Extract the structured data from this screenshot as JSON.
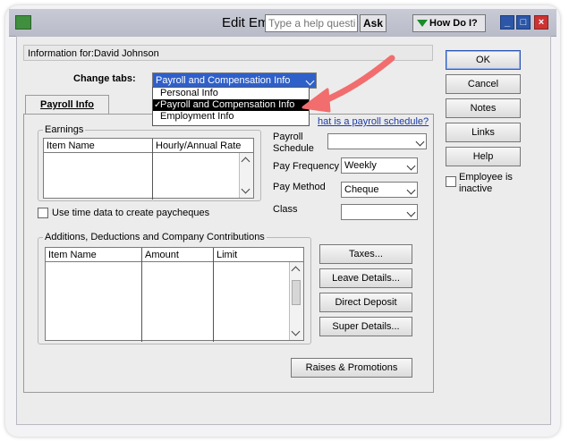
{
  "window": {
    "title": "Edit Em",
    "help_placeholder": "Type a help question",
    "ask_label": "Ask",
    "howdoi_label": "How Do I?"
  },
  "dialog": {
    "info_label": "Information for:",
    "employee_name": "David Johnson",
    "change_tabs_label": "Change tabs:",
    "change_tabs_value": "Payroll and Compensation Info",
    "dropdown_options": [
      {
        "label": "Personal Info",
        "selected": false
      },
      {
        "label": "Payroll and Compensation Info",
        "selected": true
      },
      {
        "label": "Employment Info",
        "selected": false
      }
    ],
    "tab_label": "Payroll Info",
    "schedule_link": "hat is a payroll schedule?",
    "earnings": {
      "group_title": "Earnings",
      "columns": [
        "Item Name",
        "Hourly/Annual Rate"
      ]
    },
    "use_time_data_label": "Use time data to create paycheques",
    "additions": {
      "group_title": "Additions, Deductions and Company Contributions",
      "columns": [
        "Item Name",
        "Amount",
        "Limit"
      ]
    },
    "payroll_schedule_label_1": "Payroll",
    "payroll_schedule_label_2": "Schedule",
    "payroll_schedule_value": "",
    "pay_frequency_label": "Pay Frequency",
    "pay_frequency_value": "Weekly",
    "pay_method_label": "Pay Method",
    "pay_method_value": "Cheque",
    "class_label": "Class",
    "class_value": "",
    "buttons": {
      "taxes": "Taxes...",
      "leave_details": "Leave Details...",
      "direct_deposit": "Direct Deposit",
      "super_details": "Super Details...",
      "raises": "Raises & Promotions"
    },
    "side_buttons": {
      "ok": "OK",
      "cancel": "Cancel",
      "notes": "Notes",
      "links": "Links",
      "help": "Help"
    },
    "inactive_label_1": "Employee is",
    "inactive_label_2": "inactive"
  },
  "colors": {
    "annotation_arrow": "#f26d6d",
    "selection_blue": "#2f60c9"
  }
}
